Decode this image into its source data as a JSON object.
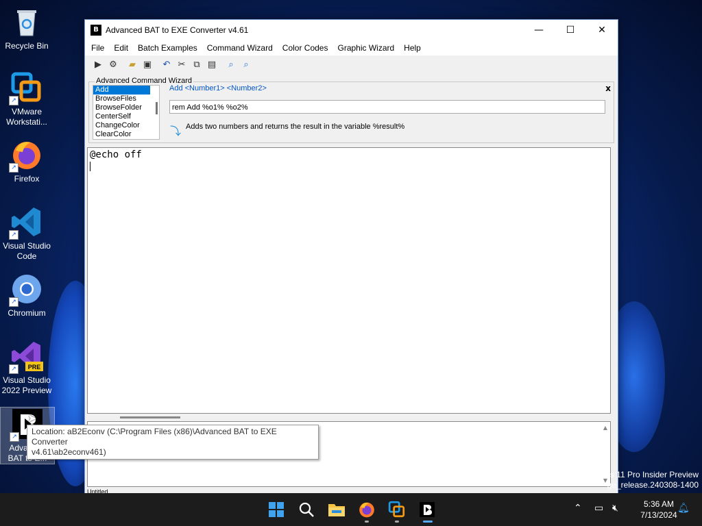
{
  "desktop": {
    "icons": [
      {
        "label": "Recycle Bin"
      },
      {
        "label": "VMware Workstati..."
      },
      {
        "label": "Firefox"
      },
      {
        "label": "Visual Studio Code"
      },
      {
        "label": "Chromium"
      },
      {
        "label": "Visual Studio 2022 Preview",
        "badge": "PRE"
      },
      {
        "label": "Advanced BAT to E..."
      }
    ]
  },
  "window": {
    "title": "Advanced BAT to EXE Converter v4.61",
    "controls": {
      "minimize": "—",
      "maximize": "☐",
      "close": "✕"
    },
    "menu": [
      "File",
      "Edit",
      "Batch Examples",
      "Command Wizard",
      "Color Codes",
      "Graphic Wizard",
      "Help"
    ],
    "toolbar_icons": [
      "run-icon",
      "compile-icon",
      "open-icon",
      "save-icon",
      "undo-icon",
      "cut-icon",
      "copy-icon",
      "paste-icon",
      "zoom-in-icon",
      "zoom-out-icon"
    ]
  },
  "wizard": {
    "legend": "Advanced Command Wizard",
    "close": "x",
    "commands": [
      "Add",
      "BrowseFiles",
      "BrowseFolder",
      "CenterSelf",
      "ChangeColor",
      "ClearColor"
    ],
    "selected": "Add",
    "syntax": "Add  <Number1>  <Number2>",
    "input_value": "rem Add %o1% %o2%",
    "description": "Adds two numbers and returns the result in the variable %result%"
  },
  "editor": {
    "content": "@echo off"
  },
  "status": {
    "text": "Untitled"
  },
  "tooltip": {
    "line1": "Location: aB2Econv (C:\\Program Files (x86)\\Advanced BAT to EXE Converter",
    "line2": "v4.61\\ab2econv461)"
  },
  "watermark": {
    "line1": "s 11 Pro Insider Preview",
    "line2": "ge_release.240308-1400"
  },
  "taskbar": {
    "time": "5:36 AM",
    "date": "7/13/2024"
  },
  "colors": {
    "accent": "#0078d7",
    "syntax": "#0055cc",
    "taskbar": "#1c1c1c"
  }
}
